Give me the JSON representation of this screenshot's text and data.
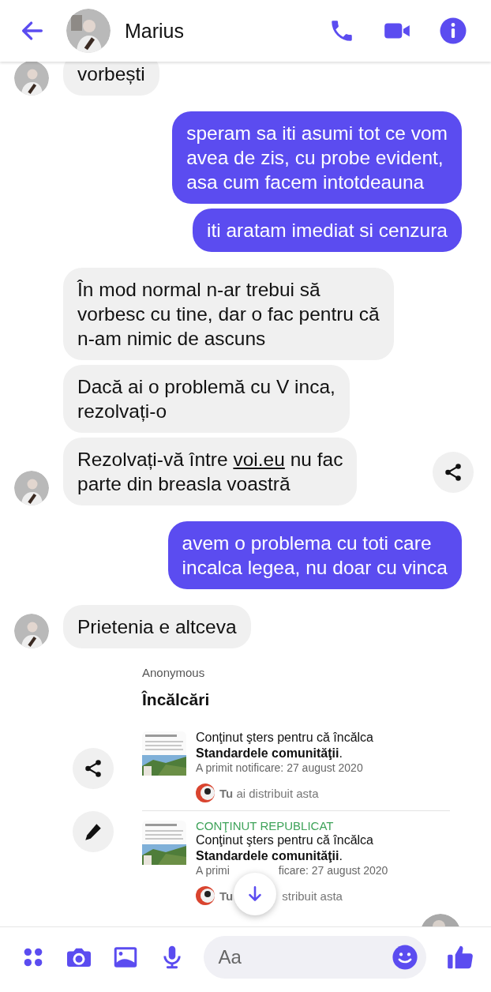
{
  "header": {
    "name": "Marius"
  },
  "messages": [
    {
      "kind": "received",
      "text": "vorbești",
      "share_button": false
    },
    {
      "kind": "sent",
      "text": "speram sa iti asumi tot ce vom\navea de zis, cu probe evident,\nasa cum facem intotdeauna"
    },
    {
      "kind": "sent",
      "text": "iti aratam imediat si cenzura"
    },
    {
      "kind": "received",
      "text": "În mod normal n-ar trebui să\nvorbesc cu tine, dar o fac pentru că\nn-am nimic de ascuns",
      "share_button": false
    },
    {
      "kind": "received",
      "text": "Dacă ai o problemă cu V inca,\nrezolvați-o",
      "share_button": false
    },
    {
      "kind": "received",
      "text": "Rezolvați-vă între ",
      "link": "voi.eu",
      "text_after": " nu fac\nparte din breasla voastră",
      "share_button": true
    },
    {
      "kind": "sent",
      "text": "avem o problema cu toti care\nincalca legea, nu doar cu vinca"
    },
    {
      "kind": "received",
      "text": "Prietenia e altceva",
      "share_button": false
    }
  ],
  "shared_post": {
    "author": "Anonymous",
    "title": "Încălcări",
    "items": [
      {
        "text": "Conţinut şters pentru că încălca **Standardele comunităţii**.",
        "date_parts": [
          "A primit notificare: 27 august 2020"
        ],
        "shared_parts": [
          "**Tu** ai distribuit asta"
        ]
      },
      {
        "tag": "CONŢINUT REPUBLICAT",
        "text": "Conţinut şters pentru că încălca **Standardele comunităţii**.",
        "date_parts": [
          "A primi",
          "ficare: 27 august 2020"
        ],
        "shared_parts": [
          "**Tu**",
          "stribuit asta"
        ]
      }
    ]
  },
  "composer": {
    "placeholder": "Aa"
  }
}
